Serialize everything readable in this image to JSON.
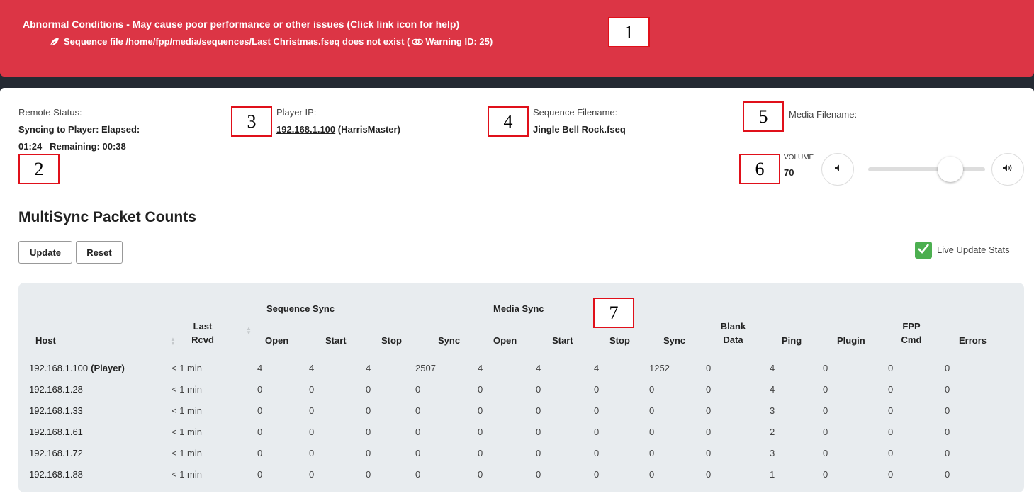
{
  "banner": {
    "title": "Abnormal Conditions - May cause poor performance or other issues (Click link icon for help)",
    "warning_prefix": "Sequence file /home/fpp/media/sequences/Last Christmas.fseq does not exist (",
    "warning_suffix": "Warning ID: 25)",
    "leaf_icon": "leaf-icon",
    "link_icon": "link-icon"
  },
  "callouts": [
    "1",
    "2",
    "3",
    "4",
    "5",
    "6",
    "7"
  ],
  "status": {
    "remote_status_label": "Remote Status:",
    "remote_status_line1": "Syncing to Player: Elapsed:",
    "remote_status_line2": "01:24   Remaining: 00:38",
    "player_ip_label": "Player IP:",
    "player_ip": "192.168.1.100",
    "player_name": "(HarrisMaster)",
    "sequence_label": "Sequence Filename:",
    "sequence_value": "Jingle Bell Rock.fseq",
    "media_label": "Media Filename:",
    "media_value": ""
  },
  "volume": {
    "label": "VOLUME",
    "value": "70",
    "level_percent": 70,
    "down_icon": "volume-down-icon",
    "up_icon": "volume-up-icon"
  },
  "multisync": {
    "title": "MultiSync Packet Counts",
    "update_label": "Update",
    "reset_label": "Reset",
    "live_update_label": "Live Update Stats",
    "live_update_checked": true,
    "accent": "#4caf50"
  },
  "table": {
    "group_headers": [
      "Sequence Sync",
      "Media Sync"
    ],
    "columns": [
      "Host",
      "Last Rcvd",
      "Open",
      "Start",
      "Stop",
      "Sync",
      "Open",
      "Start",
      "Stop",
      "Sync",
      "Blank Data",
      "Ping",
      "Plugin",
      "FPP Cmd",
      "Errors"
    ],
    "rows": [
      {
        "host": "192.168.1.100",
        "host_tag": "(Player)",
        "cells": [
          "< 1 min",
          "4",
          "4",
          "4",
          "2507",
          "4",
          "4",
          "4",
          "1252",
          "0",
          "4",
          "0",
          "0",
          "0"
        ]
      },
      {
        "host": "192.168.1.28",
        "host_tag": "",
        "cells": [
          "< 1 min",
          "0",
          "0",
          "0",
          "0",
          "0",
          "0",
          "0",
          "0",
          "0",
          "4",
          "0",
          "0",
          "0"
        ]
      },
      {
        "host": "192.168.1.33",
        "host_tag": "",
        "cells": [
          "< 1 min",
          "0",
          "0",
          "0",
          "0",
          "0",
          "0",
          "0",
          "0",
          "0",
          "3",
          "0",
          "0",
          "0"
        ]
      },
      {
        "host": "192.168.1.61",
        "host_tag": "",
        "cells": [
          "< 1 min",
          "0",
          "0",
          "0",
          "0",
          "0",
          "0",
          "0",
          "0",
          "0",
          "2",
          "0",
          "0",
          "0"
        ]
      },
      {
        "host": "192.168.1.72",
        "host_tag": "",
        "cells": [
          "< 1 min",
          "0",
          "0",
          "0",
          "0",
          "0",
          "0",
          "0",
          "0",
          "0",
          "3",
          "0",
          "0",
          "0"
        ]
      },
      {
        "host": "192.168.1.88",
        "host_tag": "",
        "cells": [
          "< 1 min",
          "0",
          "0",
          "0",
          "0",
          "0",
          "0",
          "0",
          "0",
          "0",
          "1",
          "0",
          "0",
          "0"
        ]
      }
    ]
  }
}
